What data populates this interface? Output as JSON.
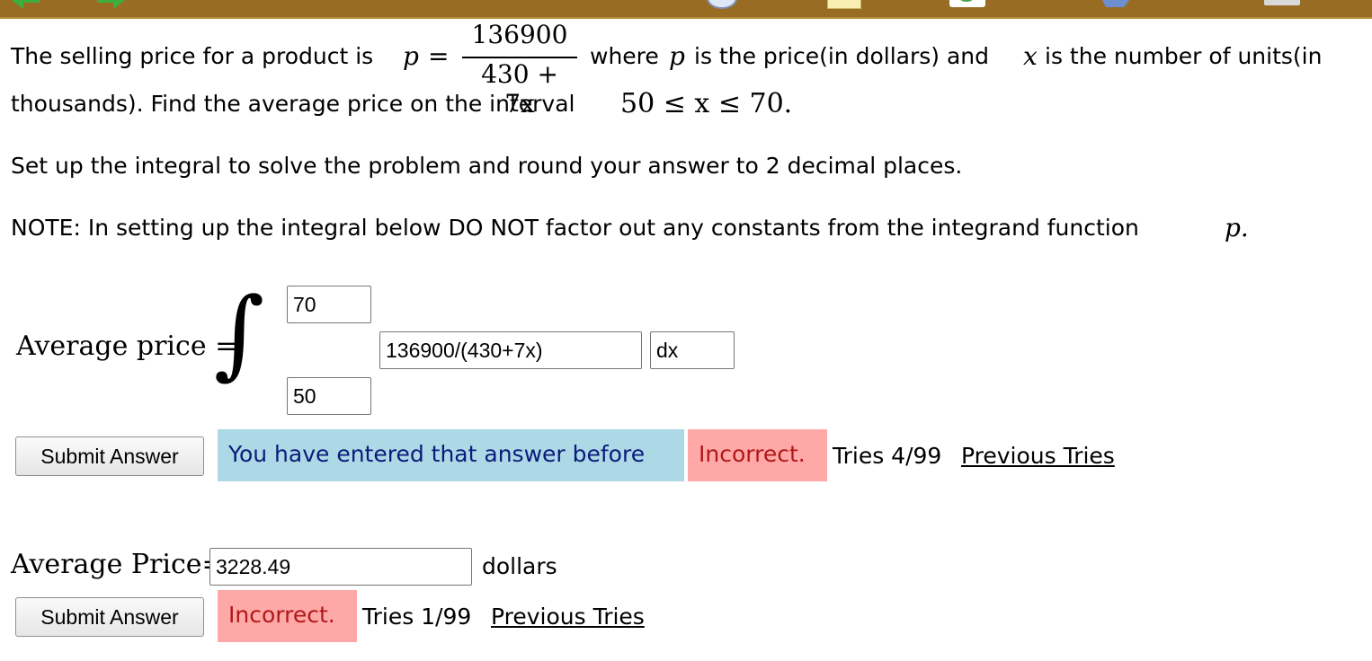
{
  "problem": {
    "line1_before": "The selling price for a product is",
    "p_var": "p",
    "equals": "=",
    "numerator": "136900",
    "denominator": "430 + 7x",
    "line1_after_1": "where",
    "line1_after_2": "is the price(in dollars) and",
    "x_var": "x",
    "line1_after_3": "is the number of units(in",
    "line2_text": "thousands). Find the average price on the interval",
    "interval": "50 ≤ x ≤ 70.",
    "instruction": "Set up the integral to solve the problem and round your answer to 2 decimal places.",
    "note_text": "NOTE: In setting up the integral below DO NOT factor out any constants from the integrand function",
    "note_var": "p."
  },
  "integral": {
    "label": "Average price =",
    "symbol": "∫",
    "upper_limit": "70",
    "lower_limit": "50",
    "integrand": "136900/(430+7x)",
    "differential": "dx"
  },
  "feedback1": {
    "submit_label": "Submit Answer",
    "info_message": "You have entered that answer before",
    "status": "Incorrect.",
    "tries": "Tries 4/99",
    "previous_link": "Previous Tries"
  },
  "answer2": {
    "label": "Average Price=",
    "value": "3228.49",
    "unit": "dollars"
  },
  "feedback2": {
    "submit_label": "Submit Answer",
    "status": "Incorrect.",
    "tries": "Tries 1/99",
    "previous_link": "Previous Tries"
  },
  "colors": {
    "toolbar": "#996c24",
    "info_banner": "#add8e6",
    "incorrect_banner": "#ffa8a8"
  }
}
